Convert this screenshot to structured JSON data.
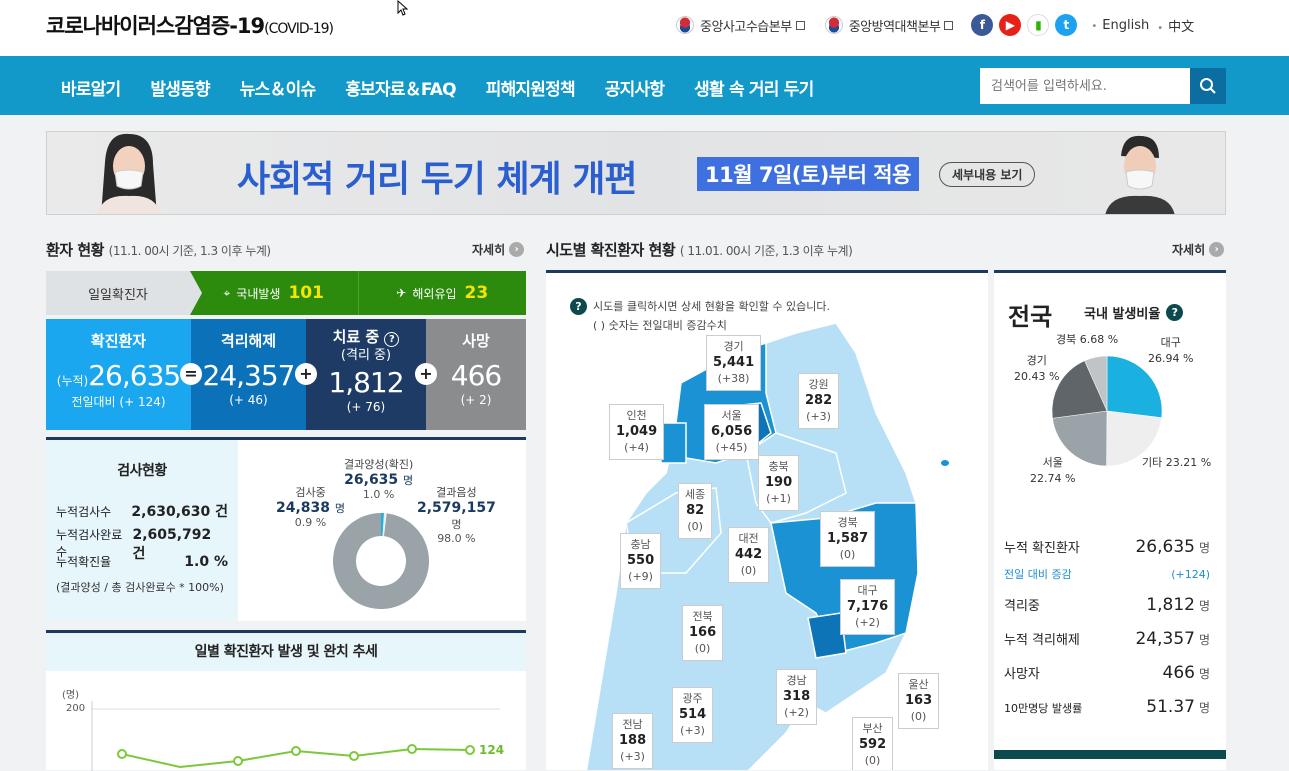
{
  "header": {
    "site_title": "코로나바이러스감염증-19",
    "site_subtitle": "(COVID-19)",
    "links": [
      "중앙사고수습본부",
      "중앙방역대책본부"
    ],
    "sns_icons": [
      "facebook-icon",
      "youtube-icon",
      "blog-icon",
      "twitter-icon"
    ],
    "langs": [
      "English",
      "中文"
    ]
  },
  "nav": {
    "items": [
      "바로알기",
      "발생동향",
      "뉴스＆이슈",
      "홍보자료＆FAQ",
      "피해지원정책",
      "공지사항",
      "생활 속 거리 두기"
    ],
    "search_placeholder": "검색어를 입력하세요."
  },
  "banner": {
    "headline": "사회적 거리 두기 체계 개편",
    "date": "11월 7일(토)부터 적용",
    "more": "세부내용 보기"
  },
  "patients": {
    "title": "환자 현황",
    "subtitle": "(11.1. 00시 기준, 1.3 이후 누계)",
    "more": "자세히",
    "daily_label": "일일확진자",
    "domestic_label": "국내발생",
    "domestic_value": "101",
    "overseas_label": "해외유입",
    "overseas_value": "23",
    "confirmed": {
      "title": "확진환자",
      "prefix": "(누적)",
      "value": "26,635",
      "delta": "전일대비 (+ 124)"
    },
    "released": {
      "title": "격리해제",
      "value": "24,357",
      "delta": "(+ 46)"
    },
    "treating": {
      "title": "치료 중",
      "sub": "(격리 중)",
      "value": "1,812",
      "delta": "(+ 76)"
    },
    "deaths": {
      "title": "사망",
      "value": "466",
      "delta": "(+ 2)"
    }
  },
  "tests": {
    "title": "검사현황",
    "rows": [
      {
        "label": "누적검사수",
        "value": "2,630,630 건"
      },
      {
        "label": "누적검사완료수",
        "value": "2,605,792 건"
      },
      {
        "label": "누적확진율",
        "value": "1.0 %"
      }
    ],
    "note": "(결과양성 / 총 검사완료수 * 100%)",
    "positive": {
      "label": "결과양성(확진)",
      "value": "26,635",
      "unit": "명",
      "pct": "1.0 %"
    },
    "testing": {
      "label": "검사중",
      "value": "24,838",
      "unit": "명",
      "pct": "0.9 %"
    },
    "negative": {
      "label": "결과음성",
      "value": "2,579,157",
      "unit": "명",
      "pct": "98.0 %"
    },
    "donut": [
      1.0,
      0.9,
      98.0
    ],
    "donut_colors": [
      "#1ab0e0",
      "#eeeeee",
      "#9aa3a8"
    ]
  },
  "trend": {
    "title": "일별 확진환자 발생 및 완치 추세",
    "unit": "(명)",
    "ytick": "200",
    "last_label": "124"
  },
  "regions": {
    "title": "시도별 확진환자 현황",
    "subtitle": "( 11.01. 00시 기준, 1.3 이후 누계)",
    "more": "자세히",
    "note1": "시도를 클릭하시면 상세 현황을 확인할 수 있습니다.",
    "note2": "( ) 숫자는 전일대비 증감수치",
    "items": [
      {
        "name": "경기",
        "value": "5,441",
        "delta": "(+38)"
      },
      {
        "name": "강원",
        "value": "282",
        "delta": "(+3)"
      },
      {
        "name": "인천",
        "value": "1,049",
        "delta": "(+4)"
      },
      {
        "name": "서울",
        "value": "6,056",
        "delta": "(+45)"
      },
      {
        "name": "충북",
        "value": "190",
        "delta": "(+1)"
      },
      {
        "name": "세종",
        "value": "82",
        "delta": "(0)"
      },
      {
        "name": "경북",
        "value": "1,587",
        "delta": "(0)"
      },
      {
        "name": "충남",
        "value": "550",
        "delta": "(+9)"
      },
      {
        "name": "대전",
        "value": "442",
        "delta": "(0)"
      },
      {
        "name": "대구",
        "value": "7,176",
        "delta": "(+2)"
      },
      {
        "name": "전북",
        "value": "166",
        "delta": "(0)"
      },
      {
        "name": "경남",
        "value": "318",
        "delta": "(+2)"
      },
      {
        "name": "울산",
        "value": "163",
        "delta": "(0)"
      },
      {
        "name": "광주",
        "value": "514",
        "delta": "(+3)"
      },
      {
        "name": "전남",
        "value": "188",
        "delta": "(+3)"
      },
      {
        "name": "부산",
        "value": "592",
        "delta": "(0)"
      }
    ]
  },
  "nation": {
    "title": "전국",
    "ratio_label": "국내 발생비율",
    "pie": [
      {
        "name": "대구",
        "pct": "26.94 %",
        "color": "#1ab0e0",
        "value": 26.94
      },
      {
        "name": "기타",
        "pct": "23.21 %",
        "color": "#eeeeee",
        "value": 23.21
      },
      {
        "name": "서울",
        "pct": "22.74 %",
        "color": "#9aa3a8",
        "value": 22.74
      },
      {
        "name": "경기",
        "pct": "20.43 %",
        "color": "#5f6568",
        "value": 20.43
      },
      {
        "name": "경북",
        "pct": "6.68 %",
        "color": "#c0c4c6",
        "value": 6.68
      }
    ],
    "rows": [
      {
        "label": "누적 확진환자",
        "value": "26,635",
        "unit": "명"
      },
      {
        "label": "전일 대비 증감",
        "value": "(+124)",
        "unit": ""
      },
      {
        "label": "격리중",
        "value": "1,812",
        "unit": "명"
      },
      {
        "label": "누적 격리해제",
        "value": "24,357",
        "unit": "명"
      },
      {
        "label": "사망자",
        "value": "466",
        "unit": "명"
      },
      {
        "label": "10만명당 발생률",
        "value": "51.37",
        "unit": "명"
      }
    ]
  }
}
